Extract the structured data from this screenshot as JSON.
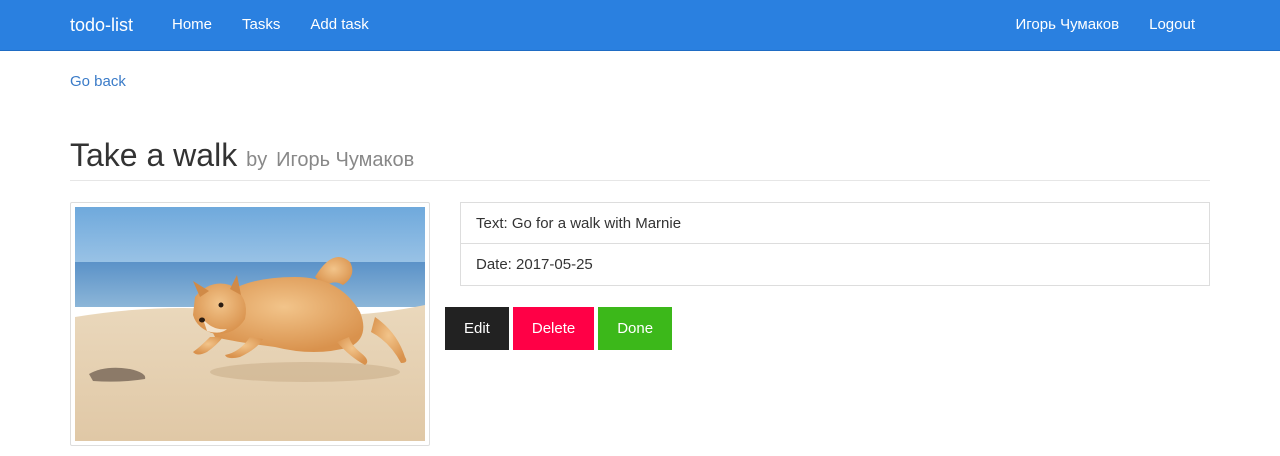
{
  "navbar": {
    "brand": "todo-list",
    "links": [
      "Home",
      "Tasks",
      "Add task"
    ],
    "user": "Игорь Чумаков",
    "logout": "Logout"
  },
  "go_back": "Go back",
  "task": {
    "title": "Take a walk",
    "by": "by",
    "author": "Игорь Чумаков",
    "text_line": "Text: Go for a walk with Marnie",
    "date_line": "Date: 2017-05-25"
  },
  "actions": {
    "edit": "Edit",
    "delete": "Delete",
    "done": "Done"
  },
  "colors": {
    "navbar": "#2a80e0",
    "link": "#3a7bc8",
    "edit": "#222222",
    "delete": "#ff0046",
    "done": "#3cb81a"
  }
}
